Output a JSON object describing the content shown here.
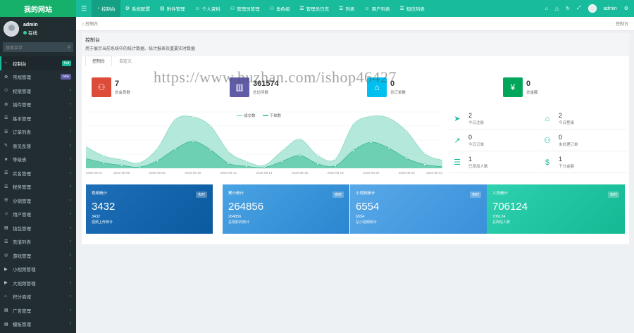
{
  "brand": "我的网站",
  "topnav": [
    {
      "icon": "dashboard-icon",
      "label": "控制台",
      "active": true
    },
    {
      "icon": "cog-icon",
      "label": "系统配置"
    },
    {
      "icon": "file-icon",
      "label": "附件管理"
    },
    {
      "icon": "user-icon",
      "label": "个人资料"
    },
    {
      "icon": "users-icon",
      "label": "管理员管理"
    },
    {
      "icon": "group-icon",
      "label": "角色组"
    },
    {
      "icon": "list-icon",
      "label": "管理员日志"
    },
    {
      "icon": "list-icon",
      "label": "列表"
    },
    {
      "icon": "user-icon",
      "label": "用户列表"
    },
    {
      "icon": "list-icon",
      "label": "短信列表"
    }
  ],
  "topright": {
    "username": "admin"
  },
  "sidebar": {
    "user": {
      "name": "admin",
      "status": "在线"
    },
    "search_placeholder": "搜索菜单",
    "items": [
      {
        "label": "控制台",
        "badge": "hot",
        "badge_color": "#18bc9c",
        "active": true
      },
      {
        "label": "常规管理",
        "badge": "new",
        "badge_color": "#605ca8"
      },
      {
        "label": "权限管理",
        "badge": "",
        "arrow": true
      },
      {
        "label": "插件管理",
        "badge": "",
        "arrow": true
      },
      {
        "label": "基本管理",
        "badge": "",
        "arrow": true
      },
      {
        "label": "订单列表",
        "badge": "",
        "arrow": true
      },
      {
        "label": "意见反馈",
        "badge": "",
        "arrow": true
      },
      {
        "label": "等级表",
        "badge": "",
        "arrow": true
      },
      {
        "label": "实名管理",
        "badge": "",
        "arrow": true
      },
      {
        "label": "税务管理",
        "badge": "",
        "arrow": true
      },
      {
        "label": "分销管理",
        "badge": "",
        "arrow": true
      },
      {
        "label": "用户管理",
        "badge": "",
        "arrow": true
      },
      {
        "label": "钱包管理",
        "badge": "",
        "arrow": true
      },
      {
        "label": "充值列表",
        "badge": "",
        "arrow": true
      },
      {
        "label": "游戏管理",
        "badge": "",
        "arrow": true
      },
      {
        "label": "小视频管理",
        "badge": "",
        "arrow": true
      },
      {
        "label": "大视频管理",
        "badge": "",
        "arrow": true
      },
      {
        "label": "积分商城",
        "badge": "",
        "arrow": true
      },
      {
        "label": "广告管理",
        "badge": "",
        "arrow": true
      },
      {
        "label": "模板管理",
        "badge": "",
        "arrow": true
      }
    ]
  },
  "crumb": {
    "left": "控制台",
    "right": "控制台"
  },
  "panel": {
    "title": "控制台",
    "subtitle": "用于展示当前系统中的统计数据、统计报表及重要实时数据",
    "tabs": [
      "控制台",
      "自定义"
    ]
  },
  "stats": [
    {
      "value": "7",
      "label": "总会员数",
      "color": "#dd4b39",
      "icon": "users-icon"
    },
    {
      "value": "361574",
      "label": "总访问数",
      "color": "#605ca8",
      "icon": "book-icon"
    },
    {
      "value": "0",
      "label": "总订单数",
      "color": "#00c0ef",
      "icon": "cart-icon"
    },
    {
      "value": "0",
      "label": "总金额",
      "color": "#00a65a",
      "icon": "yen-icon"
    }
  ],
  "legend": [
    {
      "label": "成交数",
      "color": "#a6e4d4"
    },
    {
      "label": "下单数",
      "color": "#5cc9a7"
    }
  ],
  "chart_data": {
    "type": "area",
    "x": [
      "2020-08-04",
      "2020-08-05",
      "2020-08-06",
      "2020-08-07",
      "2020-08-08",
      "2020-08-09",
      "2020-08-10",
      "2020-08-11",
      "2020-08-12",
      "2020-08-13",
      "2020-08-14",
      "2020-08-15",
      "2020-08-16",
      "2020-08-17",
      "2020-08-18",
      "2020-08-19",
      "2020-08-20",
      "2020-08-21",
      "2020-08-22",
      "2020-08-23",
      "2020-08-24"
    ],
    "series": [
      {
        "name": "成交数",
        "values": [
          88,
          50,
          35,
          22,
          80,
          198,
          210,
          172,
          68,
          28,
          12,
          70,
          118,
          52,
          38,
          178,
          212,
          205,
          150,
          60,
          32
        ],
        "color": "#a6e4d4"
      },
      {
        "name": "下单数",
        "values": [
          40,
          22,
          12,
          5,
          30,
          78,
          110,
          75,
          20,
          8,
          3,
          28,
          52,
          18,
          10,
          72,
          106,
          82,
          40,
          15,
          6
        ],
        "color": "#5cc9a7"
      }
    ],
    "xlabel": "",
    "ylabel": "",
    "ylim": [
      0,
      230
    ]
  },
  "minis": [
    {
      "value": "2",
      "label": "今日注册",
      "icon": "rocket-icon"
    },
    {
      "value": "2",
      "label": "今日登录",
      "icon": "cart-icon"
    },
    {
      "value": "0",
      "label": "今日订单",
      "icon": "line-chart-icon"
    },
    {
      "value": "0",
      "label": "未处理订单",
      "icon": "users-icon"
    },
    {
      "value": "1",
      "label": "已添加人数",
      "icon": "list-icon"
    },
    {
      "value": "1",
      "label": "下分金额",
      "icon": "dollar-icon"
    }
  ],
  "cards": [
    {
      "title": "视频统计",
      "tag": "实时",
      "value": "3432",
      "sub": "3432",
      "desc": "视频上传统计",
      "color1": "#1e6fb8",
      "color2": "#0a5aa0"
    },
    {
      "title": "累计统计",
      "tag": "实时",
      "value": "264856",
      "sub": "264856",
      "desc": "总观影的统计",
      "color1": "#4aa3e3",
      "color2": "#2b86d0"
    },
    {
      "title": "小视频统计",
      "tag": "实时",
      "value": "6554",
      "sub": "6554",
      "desc": "总小视频统计",
      "color1": "#58a9e8",
      "color2": "#3a90da"
    },
    {
      "title": "人员统计",
      "tag": "实时",
      "value": "706124",
      "sub": "706124",
      "desc": "总网站人数",
      "color1": "#2fd1b0",
      "color2": "#14b893"
    }
  ],
  "watermark": "https://www.huzhan.com/ishop46427"
}
